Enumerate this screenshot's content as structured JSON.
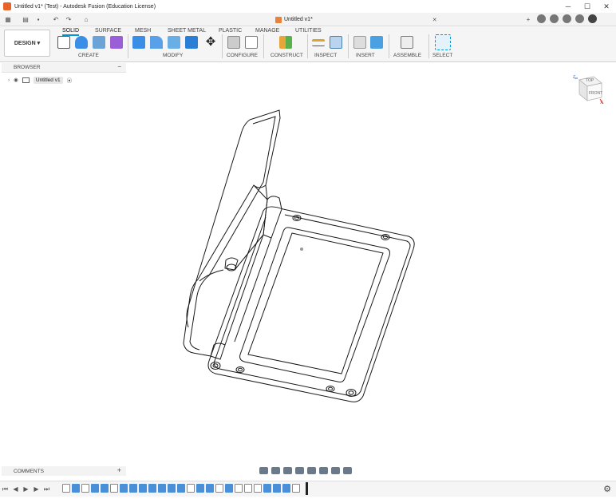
{
  "window": {
    "title": "Untitled v1* (Test) - Autodesk Fusion (Education License)"
  },
  "document_tab": {
    "label": "Untitled v1*"
  },
  "toolbar": {
    "design_label": "DESIGN",
    "workspace_tabs": [
      "SOLID",
      "SURFACE",
      "MESH",
      "SHEET METAL",
      "PLASTIC",
      "MANAGE",
      "UTILITIES"
    ],
    "active_tab": "SOLID",
    "groups": [
      "CREATE",
      "MODIFY",
      "CONFIGURE",
      "CONSTRUCT",
      "INSPECT",
      "INSERT",
      "ASSEMBLE",
      "SELECT"
    ]
  },
  "browser": {
    "header": "BROWSER",
    "root_component": "Untitled v1"
  },
  "comments": {
    "label": "COMMENTS"
  },
  "viewcube": {
    "top": "TOP",
    "front": "FRONT",
    "axis_z": "Z",
    "axis_x": "X"
  },
  "colors": {
    "accent": "#0696d7",
    "app_icon": "#e8622a",
    "timeline_feature": "#4a90d9"
  },
  "icons": {
    "titlebar": [
      "app-icon",
      "minimize-icon",
      "maximize-icon",
      "close-icon"
    ],
    "nav": [
      "orbit-icon",
      "pan-icon",
      "look-at-icon",
      "zoom-icon",
      "fit-icon",
      "display-settings-icon",
      "grid-icon",
      "viewports-icon"
    ]
  }
}
